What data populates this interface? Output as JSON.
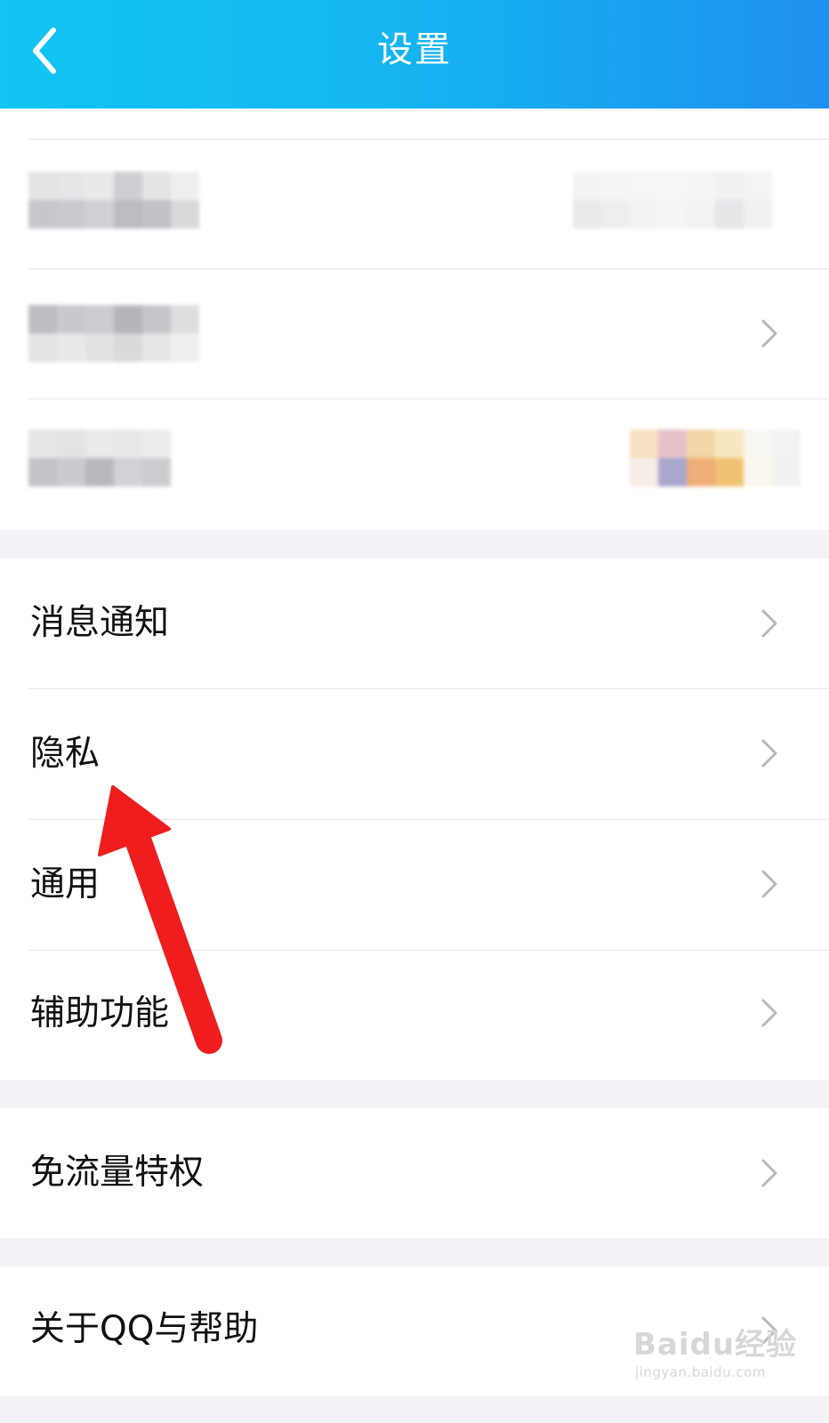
{
  "header": {
    "title": "设置",
    "back_icon": "chevron-left-icon"
  },
  "colors": {
    "header_start": "#12c5f4",
    "header_end": "#1e90ef",
    "annotation_arrow": "#ef1d1d",
    "background": "#f2f3f6"
  },
  "menu": {
    "notifications": "消息通知",
    "privacy": "隐私",
    "general": "通用",
    "accessibility": "辅助功能",
    "free_data": "免流量特权",
    "about": "关于QQ与帮助"
  },
  "watermark": {
    "logo": "Baidu经验",
    "url": "jingyan.baidu.com"
  }
}
